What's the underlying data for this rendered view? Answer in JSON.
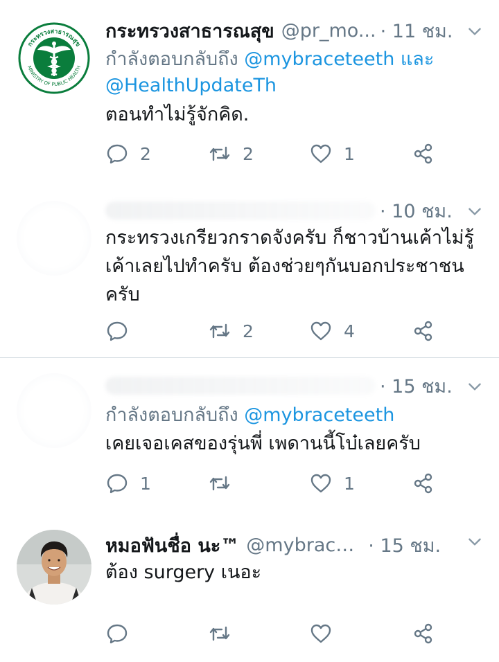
{
  "tweets": [
    {
      "name": "กระทรวงสาธารณสุข",
      "handle": "@pr_mo...",
      "time": "· 11 ชม.",
      "reply_prefix": "กำลังตอบกลับถึง ",
      "reply_mention_1": "@mybraceteeth",
      "reply_joiner": " และ",
      "reply_mention_2": "@HealthUpdateTh",
      "text": "ตอนทำไม่รู้จักคิด.",
      "replies": "2",
      "retweets": "2",
      "likes": "1",
      "avatar": "ministry-of-public-health-logo",
      "logo_text_top": "กระทรวงสาธารณสุข",
      "logo_text_bottom": "MINISTRY OF PUBLIC HEALTH"
    },
    {
      "time": "· 10 ชม.",
      "text_line_1": "กระทรวงเกรียวกราดจังครับ ก็ชาวบ้านเค้าไม่รู้",
      "text_line_2": "เค้าเลยไปทำครับ ต้องช่วยๆกันบอกประชาชน",
      "text_line_3": "ครับ",
      "replies": "",
      "retweets": "2",
      "likes": "4"
    },
    {
      "time": "· 15 ชม.",
      "reply_prefix": "กำลังตอบกลับถึง ",
      "reply_mention_1": "@mybraceteeth",
      "text": "เคยเจอเคสของรุ่นพี่ เพดานนี้โบ๋เลยครับ",
      "replies": "1",
      "retweets": "",
      "likes": "1"
    },
    {
      "name": "หมอฟันชื่อ นะ™",
      "handle": "@mybracete...",
      "time": "· 15 ชม.",
      "text": "ต้อง surgery เนอะ",
      "replies": "",
      "retweets": "",
      "likes": "",
      "avatar": "profile-photo"
    }
  ],
  "colors": {
    "text": "#14171a",
    "secondary": "#657786",
    "link": "#1b95e0",
    "divider": "#d6dde3",
    "logo_green": "#0a7d3c"
  },
  "icons": [
    "reply-icon",
    "retweet-icon",
    "like-icon",
    "share-icon",
    "chevron-down-icon"
  ]
}
